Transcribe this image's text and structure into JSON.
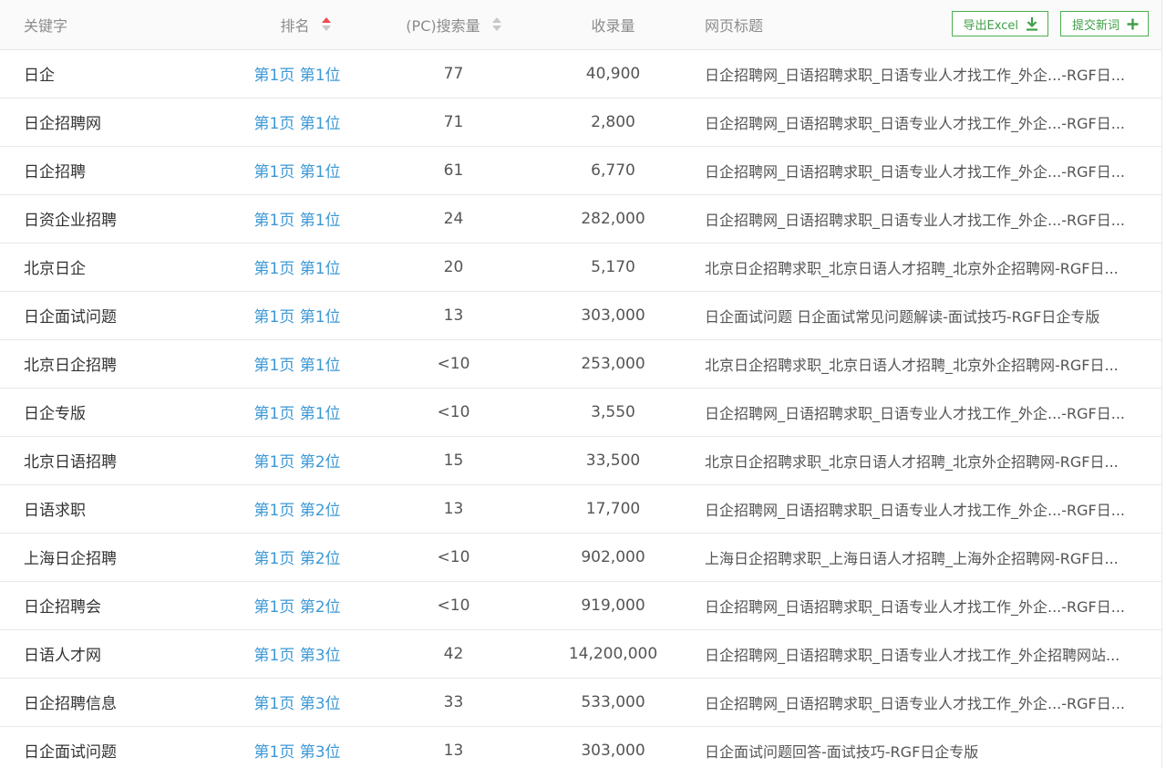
{
  "header": {
    "keyword": "关键字",
    "rank": "排名",
    "pc_search": "(PC)搜索量",
    "indexed": "收录量",
    "page_title": "网页标题",
    "export_label": "导出Excel",
    "submit_label": "提交新词",
    "icons": {
      "export": "download-icon",
      "submit": "plus-icon",
      "sort": "sort-arrows-icon"
    },
    "colors": {
      "sort_active": "#ee4d4d",
      "button_green": "#4caf50",
      "link_blue": "#3d98d6"
    }
  },
  "rows": [
    {
      "keyword": "日企",
      "rank": "第1页 第1位",
      "pc": "77",
      "indexed": "40,900",
      "title": "日企招聘网_日语招聘求职_日语专业人才找工作_外企...-RGF日..."
    },
    {
      "keyword": "日企招聘网",
      "rank": "第1页 第1位",
      "pc": "71",
      "indexed": "2,800",
      "title": "日企招聘网_日语招聘求职_日语专业人才找工作_外企...-RGF日..."
    },
    {
      "keyword": "日企招聘",
      "rank": "第1页 第1位",
      "pc": "61",
      "indexed": "6,770",
      "title": "日企招聘网_日语招聘求职_日语专业人才找工作_外企...-RGF日..."
    },
    {
      "keyword": "日资企业招聘",
      "rank": "第1页 第1位",
      "pc": "24",
      "indexed": "282,000",
      "title": "日企招聘网_日语招聘求职_日语专业人才找工作_外企...-RGF日..."
    },
    {
      "keyword": "北京日企",
      "rank": "第1页 第1位",
      "pc": "20",
      "indexed": "5,170",
      "title": "北京日企招聘求职_北京日语人才招聘_北京外企招聘网-RGF日..."
    },
    {
      "keyword": "日企面试问题",
      "rank": "第1页 第1位",
      "pc": "13",
      "indexed": "303,000",
      "title": "日企面试问题 日企面试常见问题解读-面试技巧-RGF日企专版"
    },
    {
      "keyword": "北京日企招聘",
      "rank": "第1页 第1位",
      "pc": "<10",
      "indexed": "253,000",
      "title": "北京日企招聘求职_北京日语人才招聘_北京外企招聘网-RGF日..."
    },
    {
      "keyword": "日企专版",
      "rank": "第1页 第1位",
      "pc": "<10",
      "indexed": "3,550",
      "title": "日企招聘网_日语招聘求职_日语专业人才找工作_外企...-RGF日..."
    },
    {
      "keyword": "北京日语招聘",
      "rank": "第1页 第2位",
      "pc": "15",
      "indexed": "33,500",
      "title": "北京日企招聘求职_北京日语人才招聘_北京外企招聘网-RGF日..."
    },
    {
      "keyword": "日语求职",
      "rank": "第1页 第2位",
      "pc": "13",
      "indexed": "17,700",
      "title": "日企招聘网_日语招聘求职_日语专业人才找工作_外企...-RGF日..."
    },
    {
      "keyword": "上海日企招聘",
      "rank": "第1页 第2位",
      "pc": "<10",
      "indexed": "902,000",
      "title": "上海日企招聘求职_上海日语人才招聘_上海外企招聘网-RGF日..."
    },
    {
      "keyword": "日企招聘会",
      "rank": "第1页 第2位",
      "pc": "<10",
      "indexed": "919,000",
      "title": "日企招聘网_日语招聘求职_日语专业人才找工作_外企...-RGF日..."
    },
    {
      "keyword": "日语人才网",
      "rank": "第1页 第3位",
      "pc": "42",
      "indexed": "14,200,000",
      "title": "日企招聘网_日语招聘求职_日语专业人才找工作_外企招聘网站..."
    },
    {
      "keyword": "日企招聘信息",
      "rank": "第1页 第3位",
      "pc": "33",
      "indexed": "533,000",
      "title": "日企招聘网_日语招聘求职_日语专业人才找工作_外企...-RGF日..."
    },
    {
      "keyword": "日企面试问题",
      "rank": "第1页 第3位",
      "pc": "13",
      "indexed": "303,000",
      "title": "日企面试问题回答-面试技巧-RGF日企专版"
    }
  ]
}
